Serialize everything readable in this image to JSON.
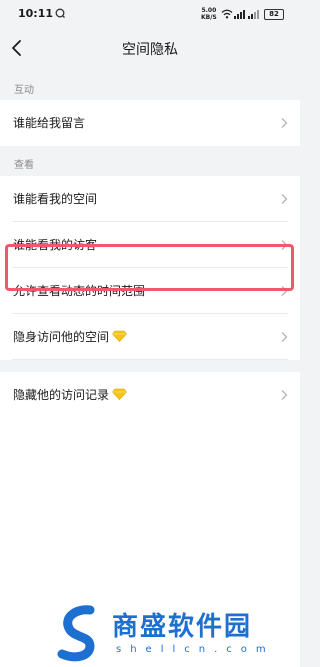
{
  "status_bar": {
    "time": "10:11",
    "speed_value": "5.00",
    "speed_unit": "KB/S",
    "battery": "82"
  },
  "nav": {
    "title": "空间隐私"
  },
  "sections": [
    {
      "label": "互动",
      "items": [
        {
          "label": "谁能给我留言"
        }
      ]
    },
    {
      "label": "查看",
      "items": [
        {
          "label": "谁能看我的空间"
        },
        {
          "label": "谁能看我的访客"
        },
        {
          "label": "允许查看动态的时间范围",
          "highlighted": true
        },
        {
          "label": "隐身访问他的空间",
          "badge_icon": "diamond-icon"
        },
        {
          "label": "隐藏他的访问记录",
          "badge_icon": "diamond-icon"
        }
      ]
    }
  ],
  "watermark": {
    "name": "商盛软件园",
    "url": "shellcn.com"
  },
  "colors": {
    "background": "#f2f3f5",
    "highlight": "#ef5a6a",
    "diamond": "#f5c518",
    "watermark": "#1d6fd0"
  }
}
